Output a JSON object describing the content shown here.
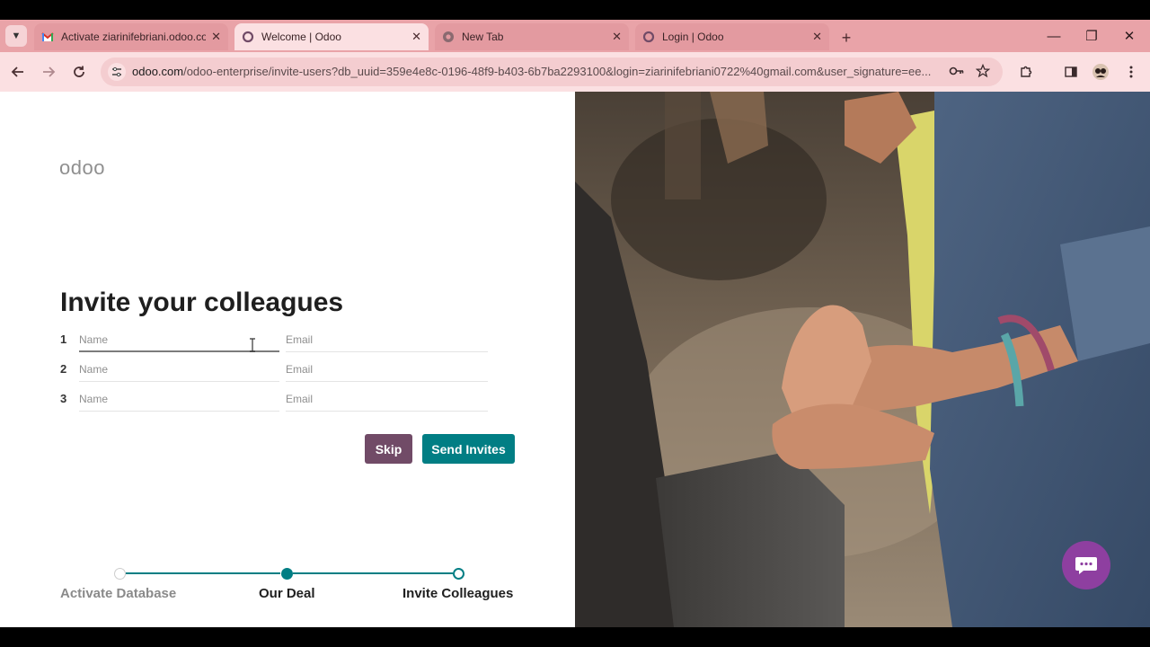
{
  "browser": {
    "tabs": [
      {
        "title": "Activate ziarinifebriani.odoo.co",
        "active": false,
        "favicon": "gmail-icon"
      },
      {
        "title": "Welcome | Odoo",
        "active": true,
        "favicon": "odoo-icon"
      },
      {
        "title": "New Tab",
        "active": false,
        "favicon": "chrome-icon"
      },
      {
        "title": "Login | Odoo",
        "active": false,
        "favicon": "odoo-icon"
      }
    ],
    "close_glyph": "✕",
    "new_tab_glyph": "+",
    "url_host": "odoo.com",
    "url_rest": "/odoo-enterprise/invite-users?db_uuid=359e4e8c-0196-48f9-b403-6b7ba2293100&login=ziarinifebriani0722%40gmail.com&user_signature=ee...",
    "window_controls": {
      "minimize": "—",
      "restore": "❐",
      "close": "✕"
    }
  },
  "page": {
    "logo": "odoo",
    "heading_pre": "Invite your ",
    "heading_bold": "colleagues",
    "invite_rows": [
      {
        "num": "1",
        "name_placeholder": "Name",
        "email_placeholder": "Email"
      },
      {
        "num": "2",
        "name_placeholder": "Name",
        "email_placeholder": "Email"
      },
      {
        "num": "3",
        "name_placeholder": "Name",
        "email_placeholder": "Email"
      }
    ],
    "skip_label": "Skip",
    "send_label": "Send Invites",
    "steps": [
      "Activate Database",
      "Our Deal",
      "Invite Colleagues"
    ]
  },
  "colors": {
    "odoo_purple": "#714b67",
    "odoo_teal": "#017e84",
    "chrome_tab_strip": "#e9a3a8",
    "chat_bubble": "#8e3fa0"
  }
}
